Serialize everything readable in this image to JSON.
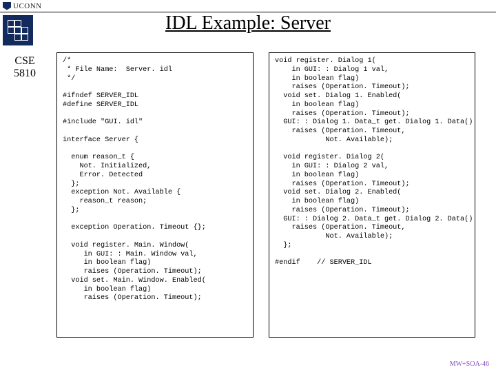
{
  "header": {
    "brand": "UCONN"
  },
  "title": "IDL Example:  Server",
  "course": {
    "line1": "CSE",
    "line2": "5810"
  },
  "code_left": "/*\n * File Name:  Server. idl\n */\n\n#ifndef SERVER_IDL\n#define SERVER_IDL\n\n#include \"GUI. idl\"\n\ninterface Server {\n\n  enum reason_t {\n    Not. Initialized,\n    Error. Detected\n  };\n  exception Not. Available {\n    reason_t reason;\n  };\n\n  exception Operation. Timeout {};\n\n  void register. Main. Window(\n     in GUI: : Main. Window val,\n     in boolean flag)\n     raises (Operation. Timeout);\n  void set. Main. Window. Enabled(\n     in boolean flag)\n     raises (Operation. Timeout);",
  "code_right": "void register. Dialog 1(\n    in GUI: : Dialog 1 val,\n    in boolean flag)\n    raises (Operation. Timeout);\n  void set. Dialog 1. Enabled(\n    in boolean flag)\n    raises (Operation. Timeout);\n  GUI: : Dialog 1. Data_t get. Dialog 1. Data()\n    raises (Operation. Timeout,\n            Not. Available);\n\n  void register. Dialog 2(\n    in GUI: : Dialog 2 val,\n    in boolean flag)\n    raises (Operation. Timeout);\n  void set. Dialog 2. Enabled(\n    in boolean flag)\n    raises (Operation. Timeout);\n  GUI: : Dialog 2. Data_t get. Dialog 2. Data()\n    raises (Operation. Timeout,\n            Not. Available);\n  };\n\n#endif    // SERVER_IDL",
  "footer": "MW+SOA-46"
}
